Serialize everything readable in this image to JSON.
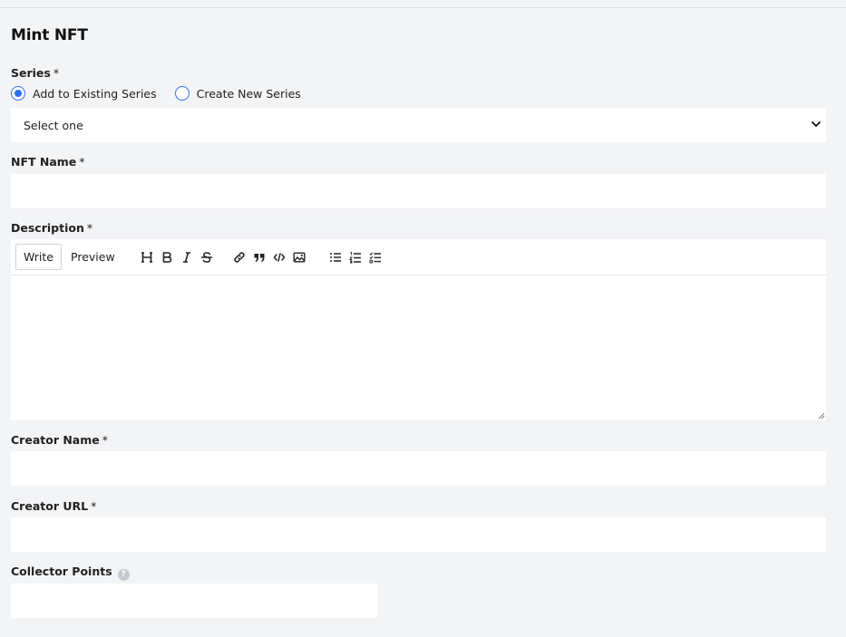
{
  "form": {
    "title": "Mint NFT",
    "required_marker": "*",
    "series": {
      "label": "Series",
      "options": [
        "Add to Existing Series",
        "Create New Series"
      ],
      "selected_option": "Add to Existing Series",
      "select_value": "Select one"
    },
    "nft_name": {
      "label": "NFT Name",
      "value": ""
    },
    "description": {
      "label": "Description",
      "tabs": [
        "Write",
        "Preview"
      ],
      "active_tab": "Write",
      "toolbar_icons": [
        "heading-icon",
        "bold-icon",
        "italic-icon",
        "strikethrough-icon",
        "link-icon",
        "quote-icon",
        "code-icon",
        "image-icon",
        "bulleted-list-icon",
        "numbered-list-icon",
        "checklist-icon"
      ],
      "value": ""
    },
    "creator_name": {
      "label": "Creator Name",
      "value": ""
    },
    "creator_url": {
      "label": "Creator URL",
      "value": ""
    },
    "collector_points": {
      "label": "Collector Points",
      "value": "",
      "help_icon": "question-circle-icon"
    }
  },
  "colors": {
    "background": "#f3f4f6",
    "field_background": "#ffffff",
    "accent": "#2f6fed"
  }
}
